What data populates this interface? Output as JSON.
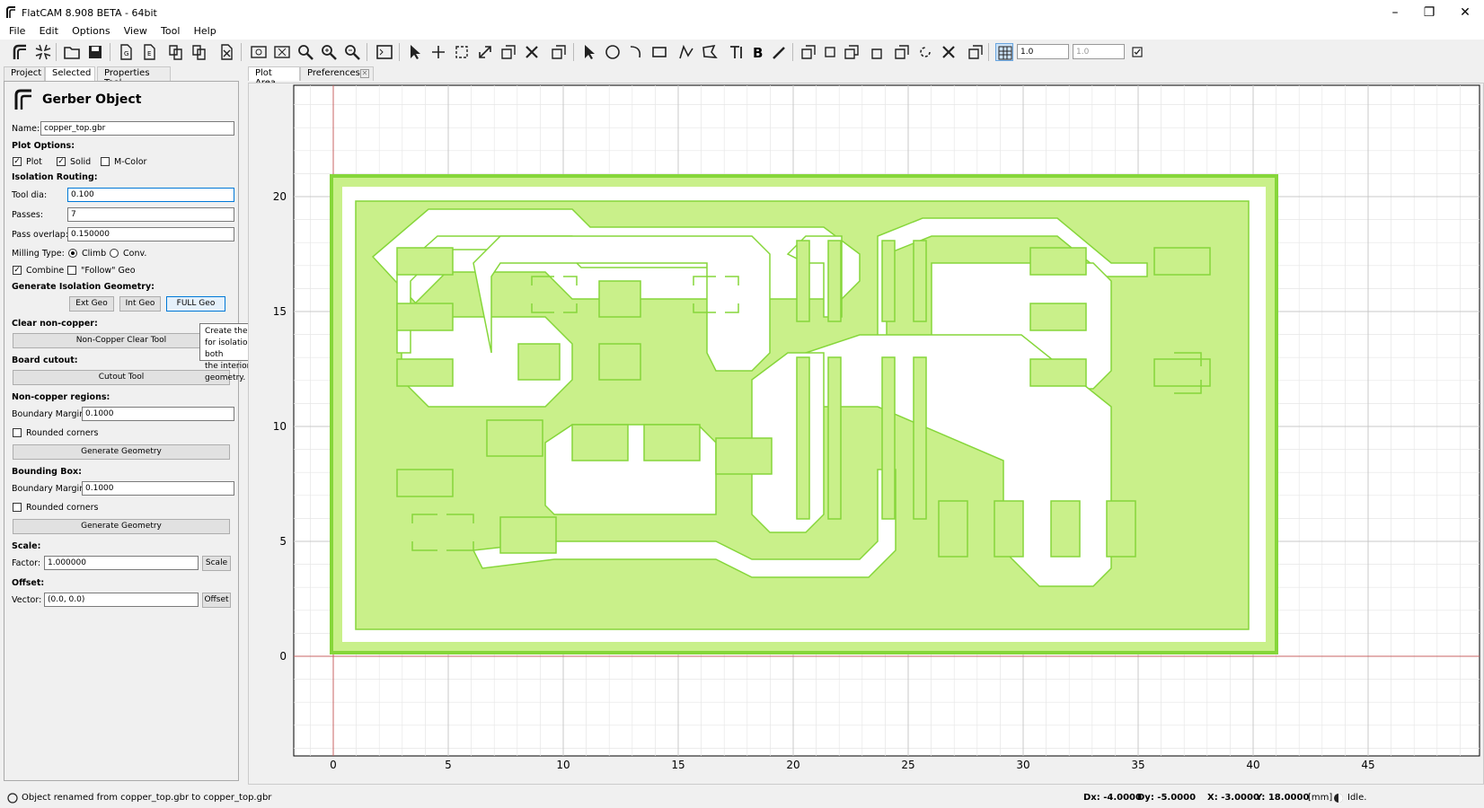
{
  "window": {
    "title": "FlatCAM 8.908 BETA - 64bit",
    "minimize": "–",
    "restore": "❐",
    "close": "✕"
  },
  "menu": [
    "File",
    "Edit",
    "Options",
    "View",
    "Tool",
    "Help"
  ],
  "toolbar": {
    "grid_x": "1.0",
    "grid_y": "1.0"
  },
  "left_tabs": [
    "Project",
    "Selected",
    "Properties Tool"
  ],
  "right_tabs": {
    "plot_area": "Plot Area",
    "preferences": "Preferences"
  },
  "panel": {
    "title": "Gerber Object",
    "name_label": "Name:",
    "name_value": "copper_top.gbr",
    "plot_options": "Plot Options:",
    "plot_cb": "Plot",
    "solid_cb": "Solid",
    "mcolor_cb": "M-Color",
    "isolation_routing": "Isolation Routing:",
    "tool_dia_label": "Tool dia:",
    "tool_dia_value": "0.100",
    "passes_label": "Passes:",
    "passes_value": "7",
    "pass_overlap_label": "Pass overlap:",
    "pass_overlap_value": "0.150000",
    "milling_type_label": "Milling Type:",
    "climb": "Climb",
    "conv": "Conv.",
    "combine": "Combine",
    "follow_geo": "\"Follow\" Geo",
    "gen_iso_geo": "Generate Isolation Geometry:",
    "ext_geo": "Ext Geo",
    "int_geo": "Int Geo",
    "full_geo": "FULL Geo",
    "clear_noncopper": "Clear non-copper:",
    "ncc_tool": "Non-Copper Clear Tool",
    "board_cutout": "Board cutout:",
    "cutout_tool": "Cutout Tool",
    "noncopper_regions": "Non-copper regions:",
    "boundary_margin_label": "Boundary Margin:",
    "boundary_margin_value": "0.1000",
    "rounded_corners": "Rounded corners",
    "generate_geometry": "Generate Geometry",
    "bounding_box": "Bounding Box:",
    "bbox_margin_value": "0.1000",
    "bbox_rounded": "Rounded corners",
    "bbox_generate": "Generate Geometry",
    "scale": "Scale:",
    "factor_label": "Factor:",
    "factor_value": "1.000000",
    "scale_btn": "Scale",
    "offset": "Offset:",
    "vector_label": "Vector:",
    "vector_value": "(0.0, 0.0)",
    "offset_btn": "Offset"
  },
  "tooltip": {
    "line1": "Create the Geometry Object",
    "line2": "for isolation routing. It contains both",
    "line3": "the interiors and exteriors geometry."
  },
  "plot": {
    "x_ticks": [
      "0",
      "5",
      "10",
      "15",
      "20",
      "25",
      "30",
      "35",
      "40",
      "45"
    ],
    "y_ticks": [
      "0",
      "5",
      "10",
      "15",
      "20"
    ],
    "trace_color": "#c9f08a",
    "outline_color": "#86d63a"
  },
  "status": {
    "message": "Object renamed from copper_top.gbr to copper_top.gbr",
    "dx": "Dx: -4.0000",
    "dy": "Dy: -5.0000",
    "x": "X: -3.0000",
    "y": "Y: 18.0000",
    "units": "[mm]",
    "state": "Idle."
  }
}
